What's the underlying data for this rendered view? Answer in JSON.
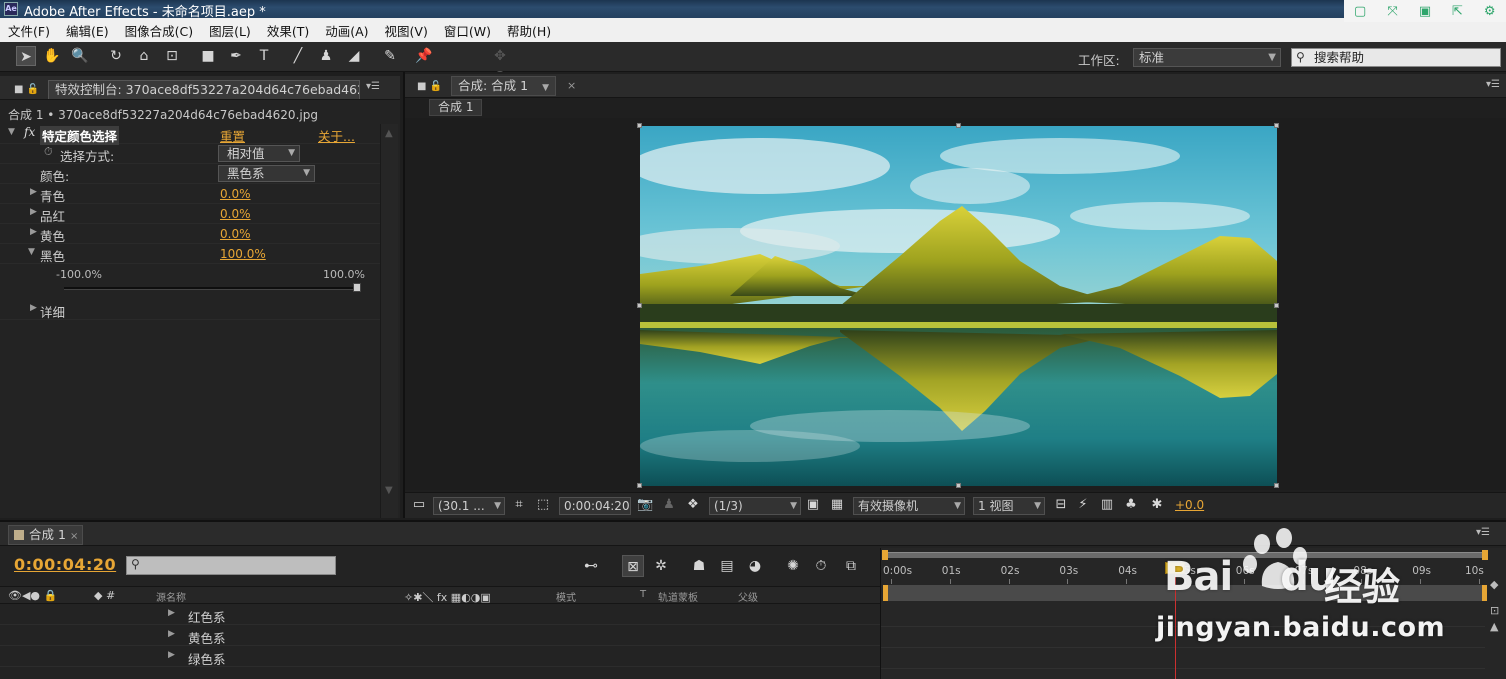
{
  "window": {
    "title": "Adobe After Effects - 未命名项目.aep *",
    "app_icon_text": "Ae"
  },
  "menu": [
    "文件(F)",
    "编辑(E)",
    "图像合成(C)",
    "图层(L)",
    "效果(T)",
    "动画(A)",
    "视图(V)",
    "窗口(W)",
    "帮助(H)"
  ],
  "toolbar": {
    "workspace_label": "工作区:",
    "workspace_value": "标准",
    "help_placeholder": "搜索帮助"
  },
  "effects_panel": {
    "tab_label": "特效控制台: 370ace8df53227a204d64c76ebad4620.jpg",
    "path": "合成 1 • 370ace8df53227a204d64c76ebad4620.jpg",
    "effect_name": "特定颜色选择",
    "reset": "重置",
    "about": "关于...",
    "method_label": "选择方式:",
    "method_value": "相对值",
    "color_label": "颜色:",
    "color_value": "黑色系",
    "params": [
      {
        "name": "青色",
        "value": "0.0%"
      },
      {
        "name": "品红",
        "value": "0.0%"
      },
      {
        "name": "黄色",
        "value": "0.0%"
      },
      {
        "name": "黑色",
        "value": "100.0%"
      }
    ],
    "slider_min": "-100.0%",
    "slider_max": "100.0%",
    "slider_value": 1.0,
    "details": "详细"
  },
  "comp_viewer": {
    "tab_label": "合成: 合成 1",
    "breadcrumb": "合成 1",
    "zoom": "(30.1 ...",
    "timecode": "0:00:04:20",
    "resolution": "(1/3)",
    "camera": "有效摄像机",
    "views": "1 视图",
    "exposure": "+0.0"
  },
  "timeline": {
    "tab_label": "合成 1",
    "timecode": "0:00:04:20",
    "columns": [
      "源名称",
      "模式",
      "T",
      "轨道蒙板",
      "父级"
    ],
    "layers": [
      "红色系",
      "黄色系",
      "绿色系"
    ],
    "ruler": [
      "0:00s",
      "01s",
      "02s",
      "03s",
      "04s",
      "05s",
      "06s",
      "07s",
      "08s",
      "09s",
      "10s"
    ],
    "current_time_sec": 4.83
  },
  "watermark": {
    "brand": "Bai",
    "brand_suffix": "du",
    "chinese": "经验",
    "url": "jingyan.baidu.com"
  },
  "colors": {
    "accent": "#e7a635",
    "panel_bg": "#232323",
    "timecode": "#e7a635"
  }
}
